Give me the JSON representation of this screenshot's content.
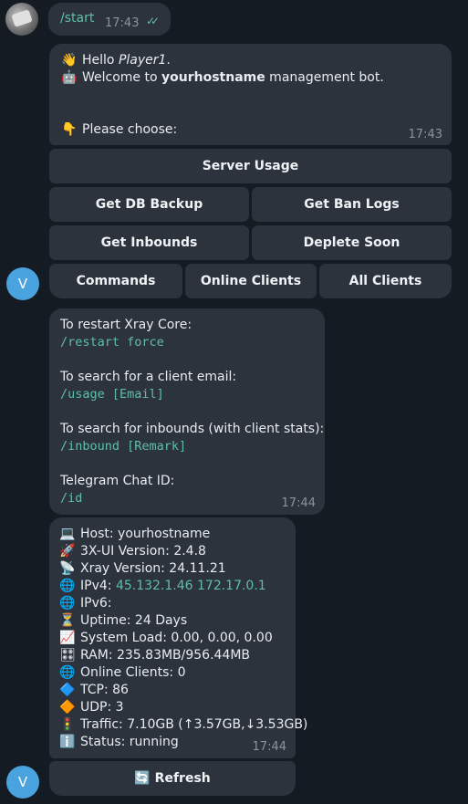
{
  "user_message": {
    "text": "/start",
    "time": "17:43"
  },
  "welcome": {
    "greeting_prefix": "Hello ",
    "player": "Player1",
    "greeting_suffix": ".",
    "welcome_prefix": "Welcome to ",
    "hostname": "yourhostname",
    "welcome_suffix": " management bot.",
    "choose": "Please choose:",
    "time": "17:43"
  },
  "keyboard": {
    "server_usage": "Server Usage",
    "db_backup": "Get DB Backup",
    "ban_logs": "Get Ban Logs",
    "inbounds": "Get Inbounds",
    "deplete_soon": "Deplete Soon",
    "commands": "Commands",
    "online_clients": "Online Clients",
    "all_clients": "All Clients"
  },
  "bot_avatar_letter": "V",
  "commands_message": {
    "restart_label": "To restart Xray Core:",
    "restart_cmd": "/restart force",
    "search_email_label": "To search for a client email:",
    "search_email_cmd": "/usage [Email]",
    "search_inbounds_label": "To search for inbounds (with client stats):",
    "search_inbounds_cmd": "/inbound [Remark]",
    "chat_id_label": "Telegram Chat ID:",
    "chat_id_cmd": "/id",
    "time": "17:44"
  },
  "status_message": {
    "host": "Host: yourhostname",
    "xui_version": "3X-UI Version: 2.4.8",
    "xray_version": "Xray Version: 24.11.21",
    "ipv4_label": "IPv4: ",
    "ipv4_a": "45.132.1.46",
    "ipv4_b": "172.17.0.1",
    "ipv6": "IPv6:",
    "uptime": "Uptime: 24 Days",
    "system_load": "System Load: 0.00, 0.00, 0.00",
    "ram": "RAM: 235.83MB/956.44MB",
    "online_clients": "Online Clients: 0",
    "tcp": "TCP: 86",
    "udp": "UDP: 3",
    "traffic": "Traffic: 7.10GB (↑3.57GB,↓3.53GB)",
    "status": "Status: running",
    "time": "17:44"
  },
  "refresh_button": "Refresh",
  "icons": {
    "wave": "👋",
    "robot": "🤖",
    "point_down": "👇",
    "computer": "💻",
    "rocket": "🚀",
    "satellite": "📡",
    "globe": "🌐",
    "hourglass": "⏳",
    "chart": "📈",
    "ram": "🎛",
    "diamond_blue": "🔷",
    "diamond_orange": "🔶",
    "traffic_light": "🚦",
    "info": "ℹ️",
    "refresh": "🔄",
    "read_checks": "✓✓"
  },
  "colors": {
    "background": "#151b22",
    "bubble": "#2c333c",
    "accent_green": "#5fbfa6",
    "avatar_blue": "#4aa3df"
  }
}
